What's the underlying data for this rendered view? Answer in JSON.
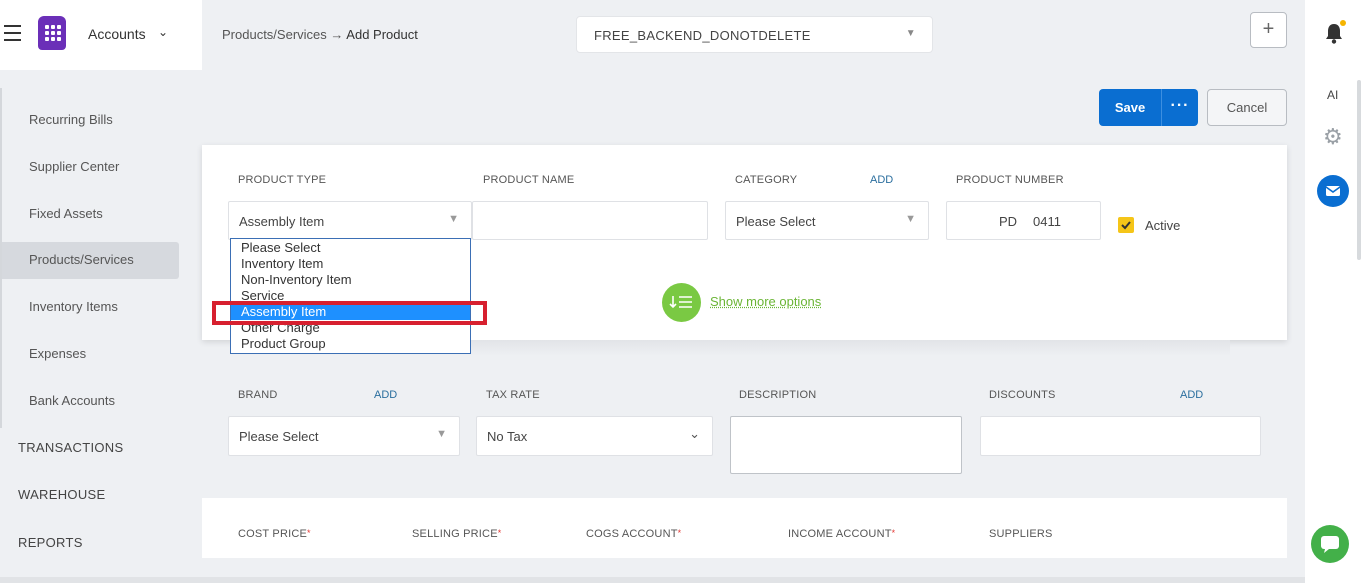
{
  "header": {
    "app_name": "Accounts",
    "breadcrumb_parent": "Products/Services",
    "breadcrumb_arrow": "→",
    "breadcrumb_current": "Add Product",
    "org_name": "FREE_BACKEND_DONOTDELETE",
    "add_button": "+"
  },
  "rail": {
    "ai_label": "AI"
  },
  "sidebar": {
    "items": [
      "Recurring Bills",
      "Supplier Center",
      "Fixed Assets",
      "Products/Services",
      "Inventory Items",
      "Expenses",
      "Bank Accounts"
    ],
    "active_item": "Products/Services",
    "sections": [
      "TRANSACTIONS",
      "WAREHOUSE",
      "REPORTS"
    ]
  },
  "actions": {
    "save": "Save",
    "more": "···",
    "cancel": "Cancel"
  },
  "form": {
    "product_type": {
      "label": "PRODUCT TYPE",
      "value": "Assembly Item"
    },
    "product_name": {
      "label": "PRODUCT NAME",
      "value": ""
    },
    "category": {
      "label": "CATEGORY",
      "add": "ADD",
      "value": "Please Select"
    },
    "product_number": {
      "label": "PRODUCT NUMBER",
      "prefix": "PD",
      "value": "0411"
    },
    "active": {
      "label": "Active",
      "checked": true
    },
    "product_type_options": [
      "Please Select",
      "Inventory Item",
      "Non-Inventory Item",
      "Service",
      "Assembly Item",
      "Other Charge",
      "Product Group"
    ],
    "selected_option": "Assembly Item",
    "show_more": "Show more options",
    "brand": {
      "label": "BRAND",
      "add": "ADD",
      "value": "Please Select"
    },
    "tax_rate": {
      "label": "TAX RATE",
      "value": "No Tax"
    },
    "description": {
      "label": "DESCRIPTION",
      "value": ""
    },
    "discounts": {
      "label": "DISCOUNTS",
      "add": "ADD",
      "value": ""
    },
    "cost_price": {
      "label": "COST PRICE",
      "required": "*"
    },
    "selling_price": {
      "label": "SELLING PRICE",
      "required": "*"
    },
    "cogs_account": {
      "label": "COGS ACCOUNT",
      "required": "*"
    },
    "income_account": {
      "label": "INCOME ACCOUNT",
      "required": "*"
    },
    "suppliers": {
      "label": "SUPPLIERS"
    }
  },
  "colors": {
    "primary": "#0a6ed1",
    "brand": "#6b2fb8",
    "highlight": "#d7202f",
    "green": "#7ac943",
    "checkbox": "#f5c518"
  },
  "icons": [
    "menu-icon",
    "app-logo-icon",
    "chevron-down-icon",
    "bell-icon",
    "gear-icon",
    "mail-icon",
    "chat-icon",
    "list-sort-icon",
    "check-icon"
  ]
}
